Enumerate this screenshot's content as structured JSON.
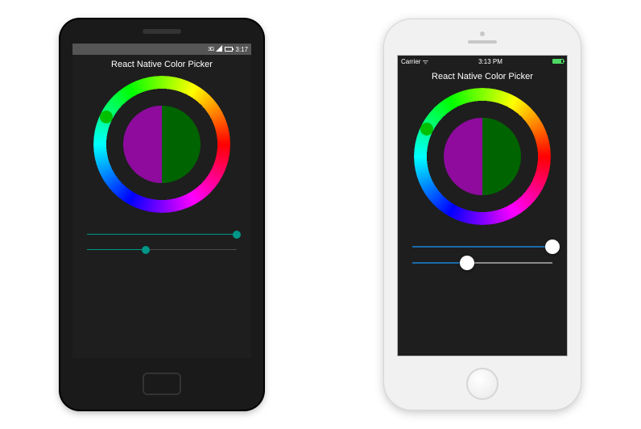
{
  "android": {
    "status": {
      "network_label": "3G",
      "time": "3:17"
    },
    "title": "React Native Color Picker",
    "hue_knob_deg": 296,
    "colors": {
      "old": "#8e0b9e",
      "new": "#006400",
      "accent": "#009688"
    },
    "sliders": {
      "saturation": 100,
      "value": 39
    }
  },
  "ios": {
    "status": {
      "carrier": "Carrier",
      "time": "3:13 PM"
    },
    "title": "React Native Color Picker",
    "hue_knob_deg": 296,
    "colors": {
      "old": "#8e0b9e",
      "new": "#006400",
      "accent": "#1a6aa9"
    },
    "sliders": {
      "saturation": 100,
      "value": 39
    }
  }
}
